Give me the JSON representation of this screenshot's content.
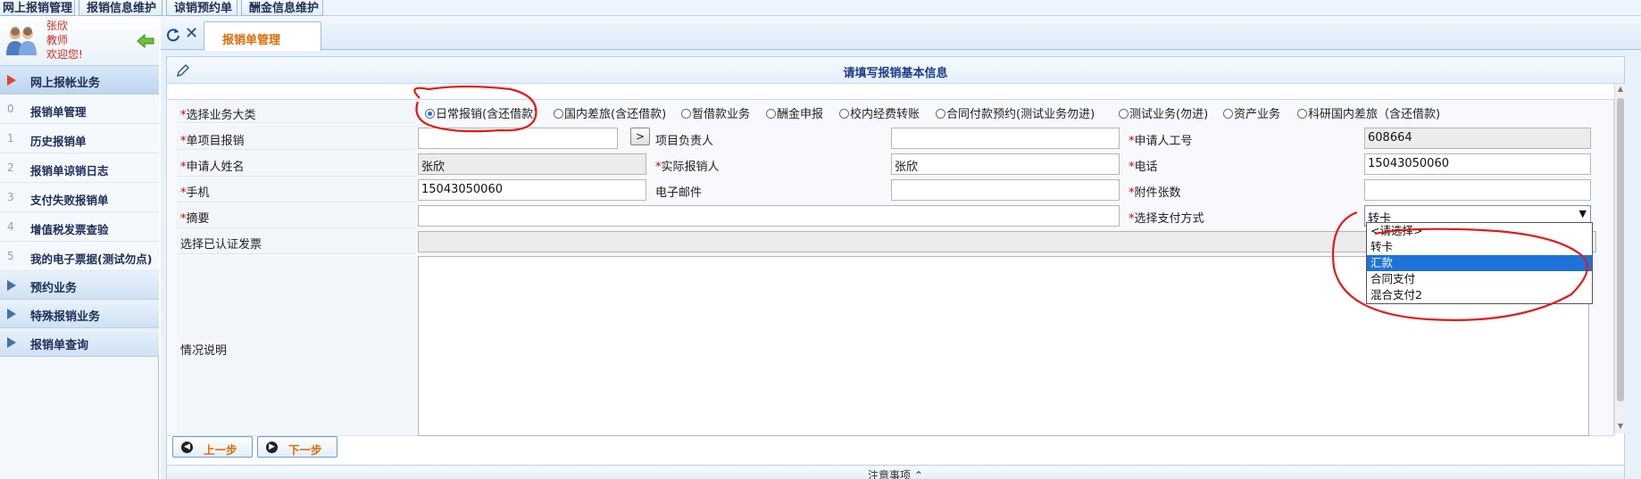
{
  "top_tabs": [
    "网上报销管理",
    "报销信息维护",
    "谅销预约单",
    "酬金信息维护"
  ],
  "user": {
    "name": "张欣",
    "role": "教师",
    "welcome": "欢迎您!"
  },
  "sidebar": {
    "sections": [
      {
        "label": "网上报帐业务",
        "open": true
      },
      {
        "label": "预约业务",
        "open": false
      },
      {
        "label": "特殊报销业务",
        "open": false
      },
      {
        "label": "报销单查询",
        "open": false
      }
    ],
    "items": [
      {
        "num": "0",
        "label": "报销单管理"
      },
      {
        "num": "1",
        "label": "历史报销单"
      },
      {
        "num": "2",
        "label": "报销单谅销日志"
      },
      {
        "num": "3",
        "label": "支付失败报销单"
      },
      {
        "num": "4",
        "label": "增值税发票查验"
      },
      {
        "num": "5",
        "label": "我的电子票据(测试勿点)"
      }
    ]
  },
  "tab": {
    "active_label": "报销单管理"
  },
  "panel": {
    "title": "请填写报销基本信息"
  },
  "form": {
    "category_label": "选择业务大类",
    "categories": [
      {
        "label": "日常报销(含还借款)",
        "checked": true
      },
      {
        "label": "国内差旅(含还借款)",
        "checked": false
      },
      {
        "label": "暂借款业务",
        "checked": false
      },
      {
        "label": "酬金申报",
        "checked": false
      },
      {
        "label": "校内经费转账",
        "checked": false
      },
      {
        "label": "合同付款预约(测试业务勿进)",
        "checked": false
      },
      {
        "label": "测试业务(勿进)",
        "checked": false
      },
      {
        "label": "资产业务",
        "checked": false
      },
      {
        "label": "科研国内差旅（含还借款)",
        "checked": false
      }
    ],
    "project_label": "单项目报销",
    "project_value": "",
    "go_label": ">",
    "leader_label": "项目负责人",
    "leader_value": "",
    "applicant_id_label": "申请人工号",
    "applicant_id_value": "608664",
    "applicant_name_label": "申请人姓名",
    "applicant_name_value": "张欣",
    "actual_label": "实际报销人",
    "actual_value": "张欣",
    "phone_label": "电话",
    "phone_value": "15043050060",
    "mobile_label": "手机",
    "mobile_value": "15043050060",
    "email_label": "电子邮件",
    "email_value": "",
    "attach_label": "附件张数",
    "attach_value": "",
    "summary_label": "摘要",
    "summary_value": "",
    "payment_label": "选择支付方式",
    "payment_value": "转卡",
    "payment_options": [
      "<请选择>",
      "转卡",
      "汇款",
      "合同支付",
      "混合支付2"
    ],
    "payment_highlighted": "汇款",
    "invoice_label": "选择已认证发票",
    "desc_label": "情况说明"
  },
  "buttons": {
    "prev": "上一步",
    "next": "下一步"
  },
  "notice": "注意事项"
}
